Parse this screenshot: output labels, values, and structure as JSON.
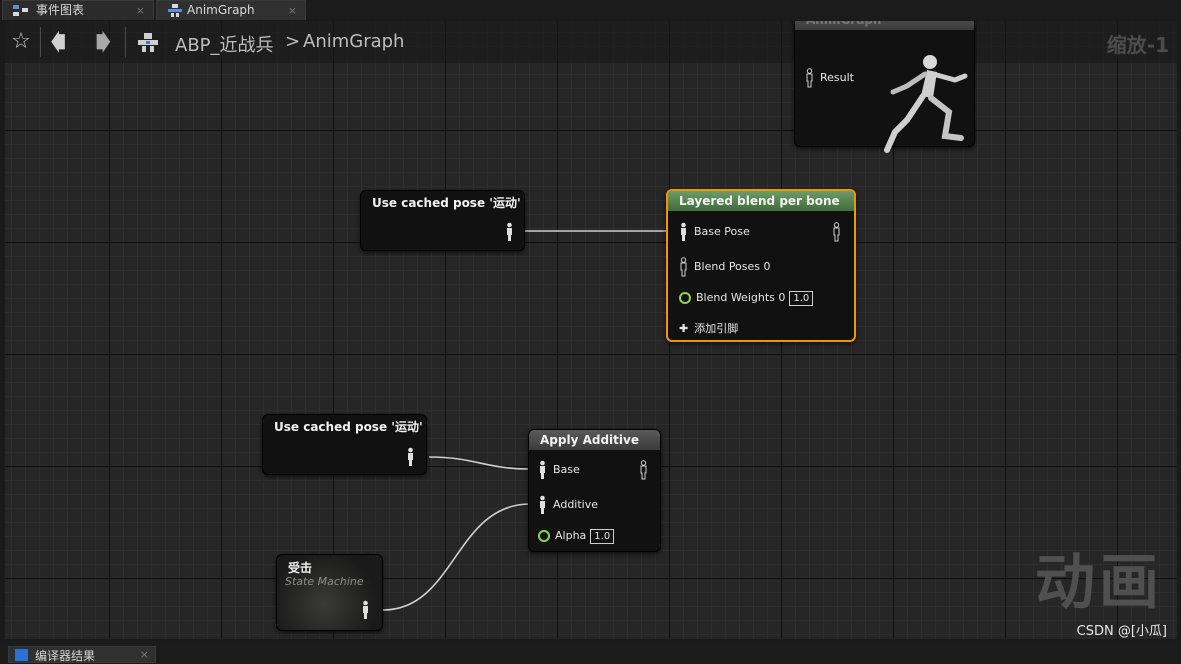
{
  "tabs": [
    {
      "label": "事件图表",
      "close": "×"
    },
    {
      "label": "AnimGraph",
      "close": "×"
    }
  ],
  "breadcrumb": {
    "star": "☆",
    "back": "🡄",
    "forward": "🡆",
    "blueprint": "ABP_近战兵",
    "separator": ">",
    "graph": "AnimGraph"
  },
  "zoom_label": "缩放-1",
  "watermark": "动画",
  "credit": "CSDN @[小瓜]",
  "nodes": {
    "result": {
      "title": "AnimGraph",
      "pin": "Result"
    },
    "cached_pose_1": {
      "title": "Use cached pose '运动'"
    },
    "layered_blend": {
      "title": "Layered blend per bone",
      "base_pose": "Base Pose",
      "blend_poses": "Blend Poses 0",
      "blend_weights": "Blend Weights 0",
      "blend_weights_value": "1.0",
      "add_pin": "添加引脚"
    },
    "cached_pose_2": {
      "title": "Use cached pose '运动'"
    },
    "apply_additive": {
      "title": "Apply Additive",
      "base": "Base",
      "additive": "Additive",
      "alpha": "Alpha",
      "alpha_value": "1.0"
    },
    "state_machine": {
      "title": "受击",
      "subtitle": "State Machine"
    }
  },
  "bottom_tab": {
    "label": "编译器结果",
    "close": "×"
  },
  "colors": {
    "accent_selected": "#f29600",
    "float_pin": "#8bd64a",
    "title_green": "#4e7c49"
  }
}
